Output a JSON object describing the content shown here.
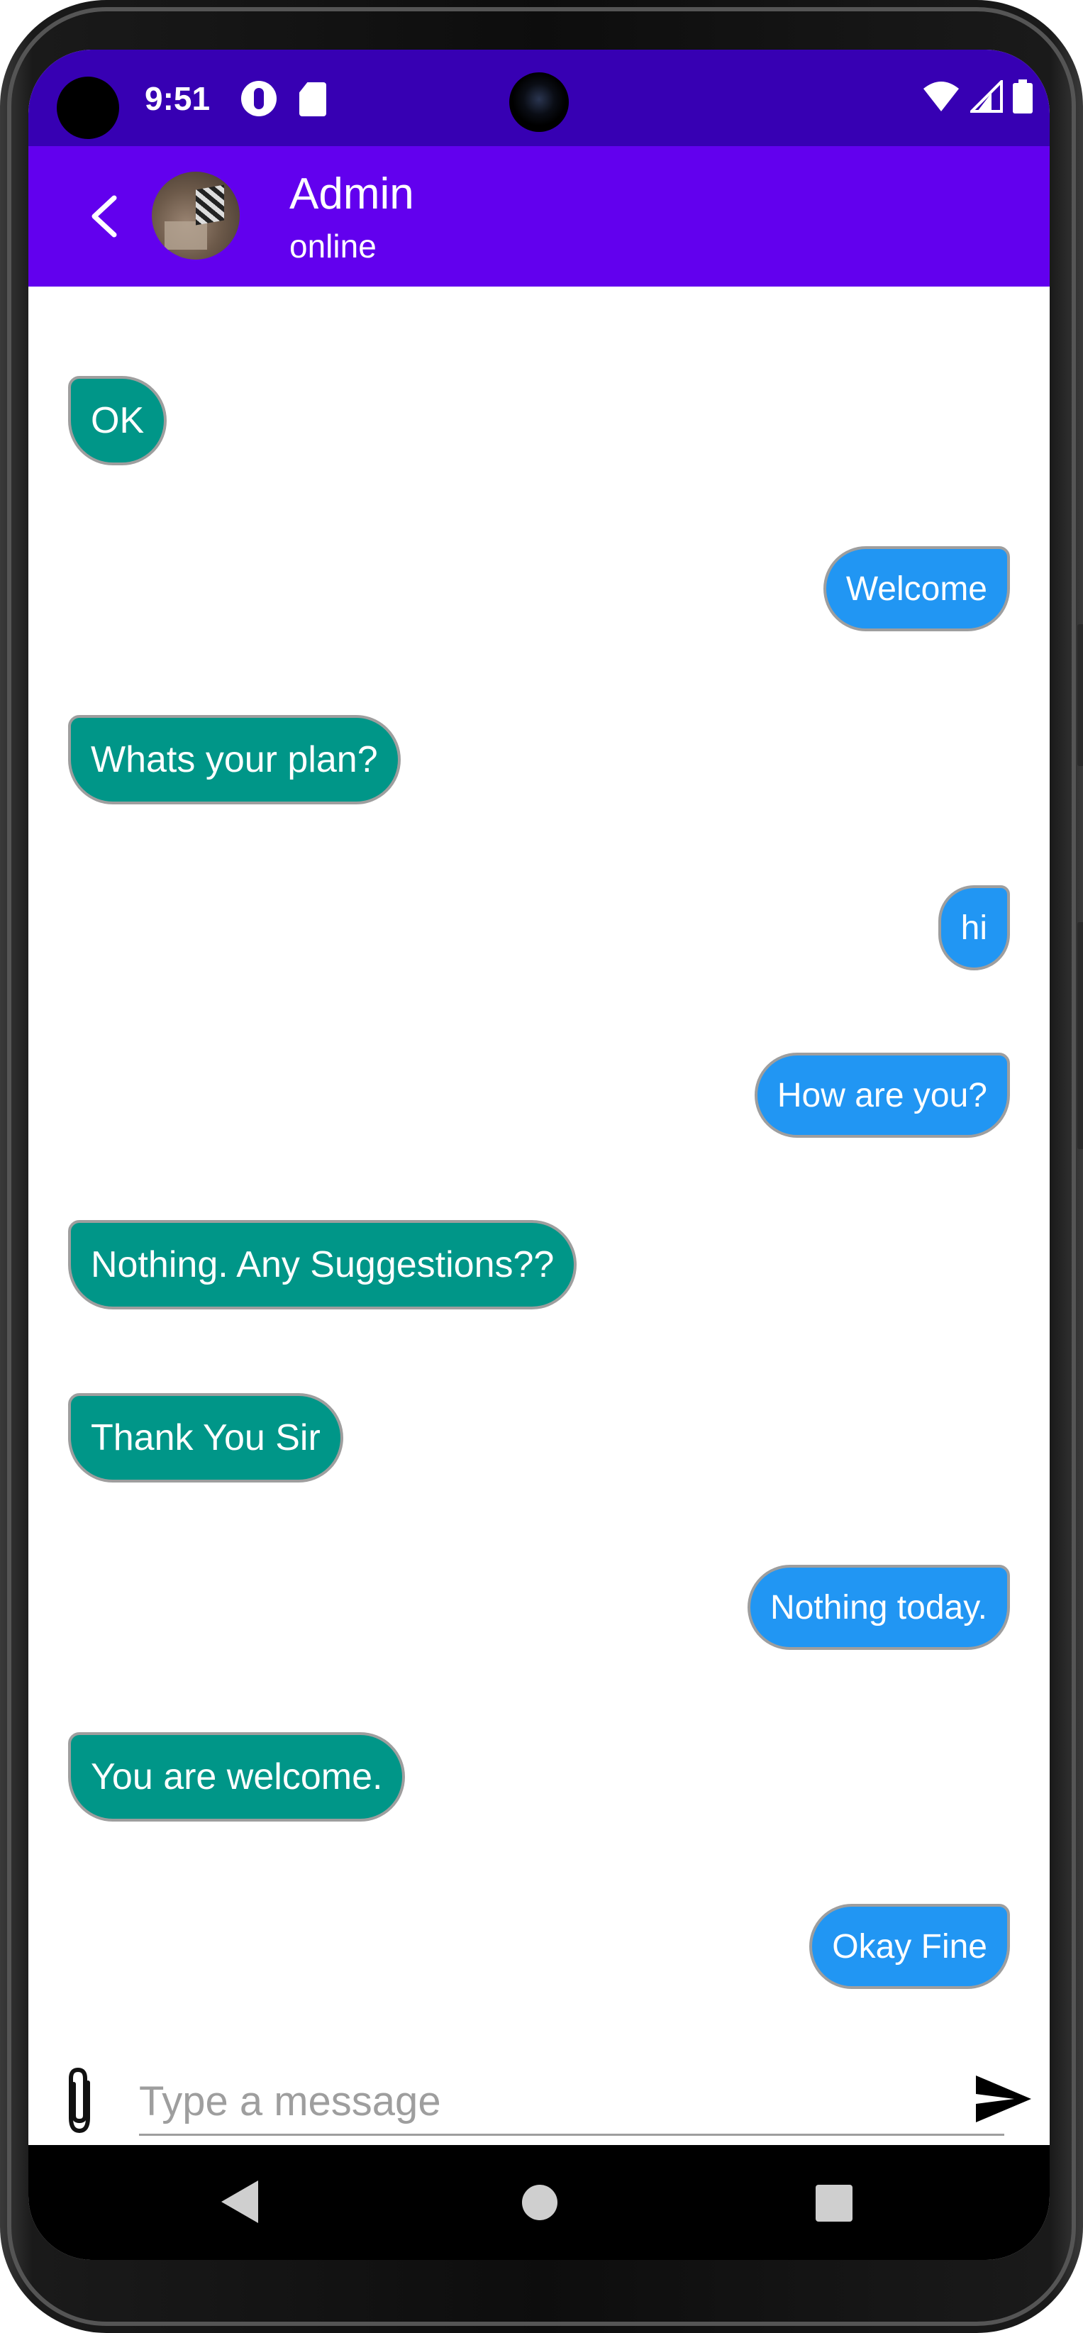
{
  "status_bar": {
    "time": "9:51",
    "icons": [
      "app-notification-icon",
      "sd-card-icon",
      "wifi-icon",
      "cell-signal-icon",
      "battery-icon"
    ]
  },
  "app_bar": {
    "title": "Admin",
    "subtitle": "online",
    "colors": {
      "status_bar": "#3700b3",
      "app_bar": "#6200ee"
    }
  },
  "messages": [
    {
      "text": "OK",
      "direction": "incoming"
    },
    {
      "text": "Welcome",
      "direction": "outgoing"
    },
    {
      "text": "Whats your plan?",
      "direction": "incoming"
    },
    {
      "text": "hi",
      "direction": "outgoing"
    },
    {
      "text": "How are you?",
      "direction": "outgoing"
    },
    {
      "text": "Nothing. Any Suggestions??",
      "direction": "incoming"
    },
    {
      "text": "Thank You Sir",
      "direction": "incoming"
    },
    {
      "text": "Nothing today.",
      "direction": "outgoing"
    },
    {
      "text": "You are welcome.",
      "direction": "incoming"
    },
    {
      "text": "Okay Fine",
      "direction": "outgoing"
    }
  ],
  "bubble_colors": {
    "incoming": "#009688",
    "outgoing": "#2196f3"
  },
  "composer": {
    "placeholder": "Type a message",
    "value": ""
  }
}
